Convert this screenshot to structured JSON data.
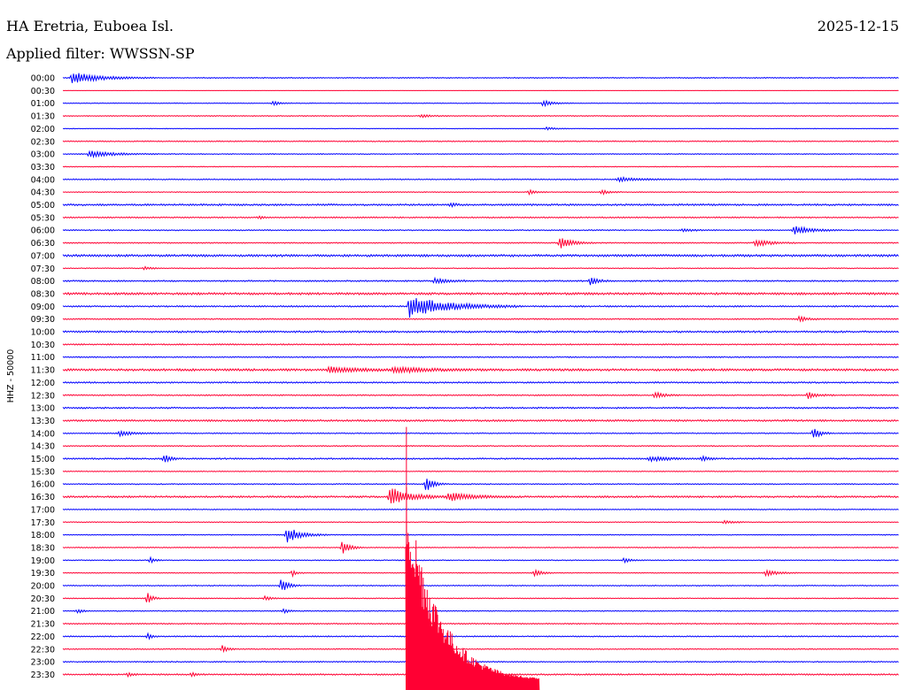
{
  "header": {
    "station": "HA Eretria, Euboea Isl.",
    "date": "2025-12-15",
    "filter": "Applied filter: WWSSN-SP"
  },
  "colors": {
    "even_hour": "#0000ff",
    "half_hour": "#ff0033"
  },
  "chart_data": {
    "type": "line",
    "subtype": "helicorder",
    "ylabel": "HHZ - 50000",
    "row_labels": [
      "00:00",
      "00:30",
      "01:00",
      "01:30",
      "02:00",
      "02:30",
      "03:00",
      "03:30",
      "04:00",
      "04:30",
      "05:00",
      "05:30",
      "06:00",
      "06:30",
      "07:00",
      "07:30",
      "08:00",
      "08:30",
      "09:00",
      "09:30",
      "10:00",
      "10:30",
      "11:00",
      "11:30",
      "12:00",
      "12:30",
      "13:00",
      "13:30",
      "14:00",
      "14:30",
      "15:00",
      "15:30",
      "16:00",
      "16:30",
      "17:00",
      "17:30",
      "18:00",
      "18:30",
      "19:00",
      "19:30",
      "20:00",
      "20:30",
      "21:00",
      "21:30",
      "22:00",
      "22:30",
      "23:00",
      "23:30"
    ],
    "minutes_per_row": 30,
    "row_noise": [
      0.5,
      0.2,
      0.4,
      0.5,
      0.3,
      0.6,
      0.5,
      0.4,
      0.6,
      0.5,
      1.0,
      0.7,
      0.6,
      0.6,
      1.2,
      0.5,
      0.8,
      1.2,
      0.8,
      0.7,
      1.0,
      0.7,
      0.7,
      1.2,
      0.8,
      0.7,
      0.8,
      1.0,
      0.6,
      0.6,
      0.8,
      0.5,
      0.6,
      1.0,
      0.5,
      0.5,
      0.5,
      0.5,
      0.5,
      0.5,
      0.5,
      0.5,
      0.6,
      0.6,
      0.6,
      0.6,
      0.6,
      0.8
    ],
    "events": [
      {
        "row": 0,
        "minute": 0.3,
        "amp": 7,
        "dur": 1.2
      },
      {
        "row": 2,
        "minute": 7.5,
        "amp": 3,
        "dur": 0.3
      },
      {
        "row": 2,
        "minute": 17.2,
        "amp": 4,
        "dur": 0.4
      },
      {
        "row": 3,
        "minute": 12.8,
        "amp": 2,
        "dur": 0.4
      },
      {
        "row": 4,
        "minute": 17.3,
        "amp": 2,
        "dur": 0.4
      },
      {
        "row": 6,
        "minute": 0.9,
        "amp": 4,
        "dur": 1.0
      },
      {
        "row": 8,
        "minute": 19.9,
        "amp": 3,
        "dur": 0.8
      },
      {
        "row": 9,
        "minute": 16.7,
        "amp": 3,
        "dur": 0.3
      },
      {
        "row": 9,
        "minute": 19.3,
        "amp": 3,
        "dur": 0.3
      },
      {
        "row": 10,
        "minute": 13.9,
        "amp": 3,
        "dur": 0.2
      },
      {
        "row": 11,
        "minute": 7.0,
        "amp": 2,
        "dur": 0.2
      },
      {
        "row": 12,
        "minute": 26.2,
        "amp": 6,
        "dur": 0.7
      },
      {
        "row": 12,
        "minute": 22.2,
        "amp": 2,
        "dur": 0.4
      },
      {
        "row": 13,
        "minute": 17.8,
        "amp": 8,
        "dur": 0.5
      },
      {
        "row": 13,
        "minute": 24.8,
        "amp": 5,
        "dur": 0.6
      },
      {
        "row": 15,
        "minute": 2.9,
        "amp": 2,
        "dur": 0.3
      },
      {
        "row": 16,
        "minute": 18.9,
        "amp": 6,
        "dur": 0.3
      },
      {
        "row": 16,
        "minute": 13.3,
        "amp": 3,
        "dur": 0.6
      },
      {
        "row": 18,
        "minute": 12.4,
        "amp": 13,
        "dur": 1.6
      },
      {
        "row": 19,
        "minute": 26.4,
        "amp": 4,
        "dur": 0.3
      },
      {
        "row": 23,
        "minute": 9.5,
        "amp": 3,
        "dur": 1.4
      },
      {
        "row": 23,
        "minute": 11.8,
        "amp": 3,
        "dur": 1.4
      },
      {
        "row": 25,
        "minute": 21.2,
        "amp": 4,
        "dur": 0.4
      },
      {
        "row": 25,
        "minute": 26.7,
        "amp": 4,
        "dur": 0.4
      },
      {
        "row": 28,
        "minute": 2.0,
        "amp": 3,
        "dur": 0.6
      },
      {
        "row": 28,
        "minute": 26.9,
        "amp": 7,
        "dur": 0.3
      },
      {
        "row": 30,
        "minute": 3.6,
        "amp": 5,
        "dur": 0.3
      },
      {
        "row": 30,
        "minute": 21.0,
        "amp": 3,
        "dur": 0.8
      },
      {
        "row": 30,
        "minute": 22.9,
        "amp": 3,
        "dur": 0.3
      },
      {
        "row": 32,
        "minute": 13.0,
        "amp": 10,
        "dur": 0.3
      },
      {
        "row": 33,
        "minute": 11.7,
        "amp": 12,
        "dur": 0.8
      },
      {
        "row": 33,
        "minute": 13.8,
        "amp": 5,
        "dur": 1.0
      },
      {
        "row": 35,
        "minute": 23.7,
        "amp": 2,
        "dur": 0.4
      },
      {
        "row": 36,
        "minute": 8.0,
        "amp": 10,
        "dur": 0.6
      },
      {
        "row": 37,
        "minute": 10.0,
        "amp": 10,
        "dur": 0.3
      },
      {
        "row": 38,
        "minute": 3.1,
        "amp": 4,
        "dur": 0.2
      },
      {
        "row": 38,
        "minute": 20.1,
        "amp": 3,
        "dur": 0.3
      },
      {
        "row": 39,
        "minute": 8.2,
        "amp": 4,
        "dur": 0.2
      },
      {
        "row": 39,
        "minute": 16.9,
        "amp": 4,
        "dur": 0.3
      },
      {
        "row": 39,
        "minute": 25.2,
        "amp": 4,
        "dur": 0.5
      },
      {
        "row": 40,
        "minute": 7.8,
        "amp": 10,
        "dur": 0.3
      },
      {
        "row": 41,
        "minute": 3.0,
        "amp": 9,
        "dur": 0.2
      },
      {
        "row": 41,
        "minute": 7.2,
        "amp": 3,
        "dur": 0.3
      },
      {
        "row": 42,
        "minute": 0.5,
        "amp": 3,
        "dur": 0.2
      },
      {
        "row": 42,
        "minute": 7.9,
        "amp": 3,
        "dur": 0.2
      },
      {
        "row": 44,
        "minute": 3.0,
        "amp": 4,
        "dur": 0.2
      },
      {
        "row": 45,
        "minute": 5.7,
        "amp": 6,
        "dur": 0.2
      },
      {
        "row": 47,
        "minute": 2.3,
        "amp": 3,
        "dur": 0.2
      },
      {
        "row": 47,
        "minute": 4.6,
        "amp": 3,
        "dur": 0.2
      }
    ],
    "mainshock": {
      "row": 33,
      "minute": 12.3,
      "peak_amp": 90,
      "coda_minutes": 4.8
    }
  }
}
